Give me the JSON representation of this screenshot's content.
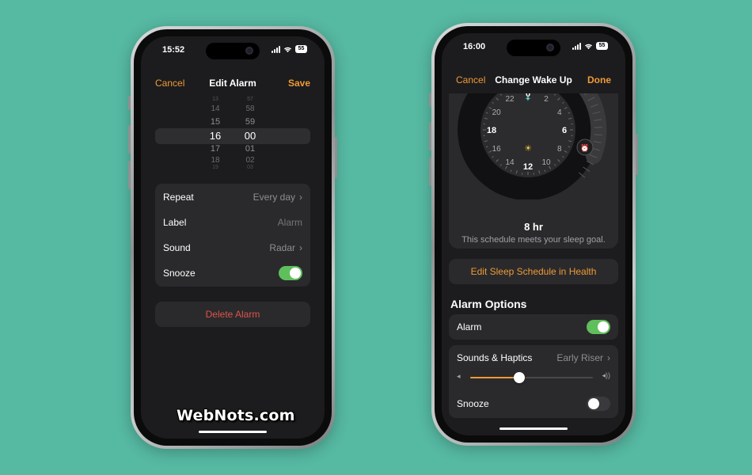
{
  "left_phone": {
    "status": {
      "time": "15:52",
      "battery": "55"
    },
    "nav": {
      "cancel": "Cancel",
      "title": "Edit Alarm",
      "save": "Save"
    },
    "picker": {
      "hours": [
        "13",
        "14",
        "15",
        "16",
        "17",
        "18",
        "19"
      ],
      "minutes": [
        "57",
        "58",
        "59",
        "00",
        "01",
        "02",
        "03"
      ],
      "selected_hour": "16",
      "selected_minute": "00"
    },
    "settings": {
      "repeat_label": "Repeat",
      "repeat_value": "Every day",
      "label_label": "Label",
      "label_placeholder": "Alarm",
      "sound_label": "Sound",
      "sound_value": "Radar",
      "snooze_label": "Snooze",
      "snooze_on": true
    },
    "delete_label": "Delete Alarm"
  },
  "right_phone": {
    "status": {
      "time": "16:00",
      "battery": "55"
    },
    "nav": {
      "cancel": "Cancel",
      "title": "Change Wake Up",
      "done": "Done"
    },
    "clock": {
      "numbers": [
        "0",
        "2",
        "4",
        "6",
        "8",
        "10",
        "12",
        "14",
        "16",
        "18",
        "20",
        "22"
      ]
    },
    "duration": "8 hr",
    "goal_text": "This schedule meets your sleep goal.",
    "edit_health_label": "Edit Sleep Schedule in Health",
    "alarm_options_title": "Alarm Options",
    "alarm_label": "Alarm",
    "alarm_on": true,
    "sounds_label": "Sounds & Haptics",
    "sounds_value": "Early Riser",
    "volume_level": 0.4,
    "snooze_label": "Snooze",
    "snooze_on": false
  },
  "watermark": "WebNots.com",
  "colors": {
    "background": "#56b9a2",
    "accent": "#f09a37",
    "toggle_on": "#5fbf5c",
    "destructive": "#e0524a"
  }
}
